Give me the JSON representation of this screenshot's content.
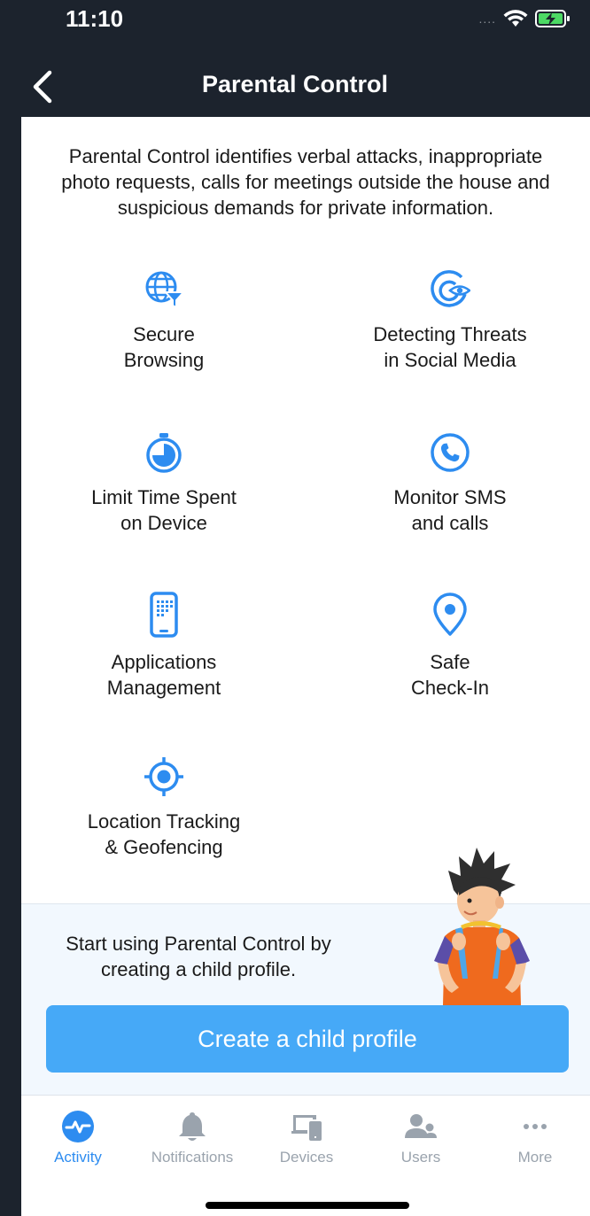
{
  "status": {
    "time": "11:10",
    "signal": "....",
    "wifi_icon": "wifi-icon",
    "battery_icon": "battery-charging-icon"
  },
  "nav": {
    "title": "Parental Control",
    "back_icon": "back-chevron-icon"
  },
  "intro": "Parental Control identifies verbal attacks, inappropriate photo requests, calls for meetings outside the house and suspicious demands for private information.",
  "features": [
    {
      "label": "Secure\nBrowsing",
      "icon": "globe-filter-icon"
    },
    {
      "label": "Detecting Threats\nin Social Media",
      "icon": "target-eye-icon"
    },
    {
      "label": "Limit Time Spent\non Device",
      "icon": "timer-icon"
    },
    {
      "label": "Monitor SMS\nand calls",
      "icon": "phone-call-icon"
    },
    {
      "label": "Applications\nManagement",
      "icon": "smartphone-apps-icon"
    },
    {
      "label": "Safe\nCheck-In",
      "icon": "map-pin-icon"
    },
    {
      "label": "Location Tracking\n& Geofencing",
      "icon": "crosshair-icon"
    }
  ],
  "promo": {
    "text": "Start using Parental Control by creating a child profile.",
    "button": "Create a child profile",
    "illustration": "child-illustration"
  },
  "tabs": [
    {
      "label": "Activity",
      "icon": "activity-pulse-icon",
      "active": true
    },
    {
      "label": "Notifications",
      "icon": "bell-icon",
      "active": false
    },
    {
      "label": "Devices",
      "icon": "devices-icon",
      "active": false
    },
    {
      "label": "Users",
      "icon": "users-icon",
      "active": false
    },
    {
      "label": "More",
      "icon": "more-dots-icon",
      "active": false
    }
  ],
  "colors": {
    "accent": "#2d8cf0",
    "button": "#46a9f7",
    "header": "#1c232d",
    "icon": "#2d8cf0",
    "tab_inactive": "#9aa3ad"
  }
}
